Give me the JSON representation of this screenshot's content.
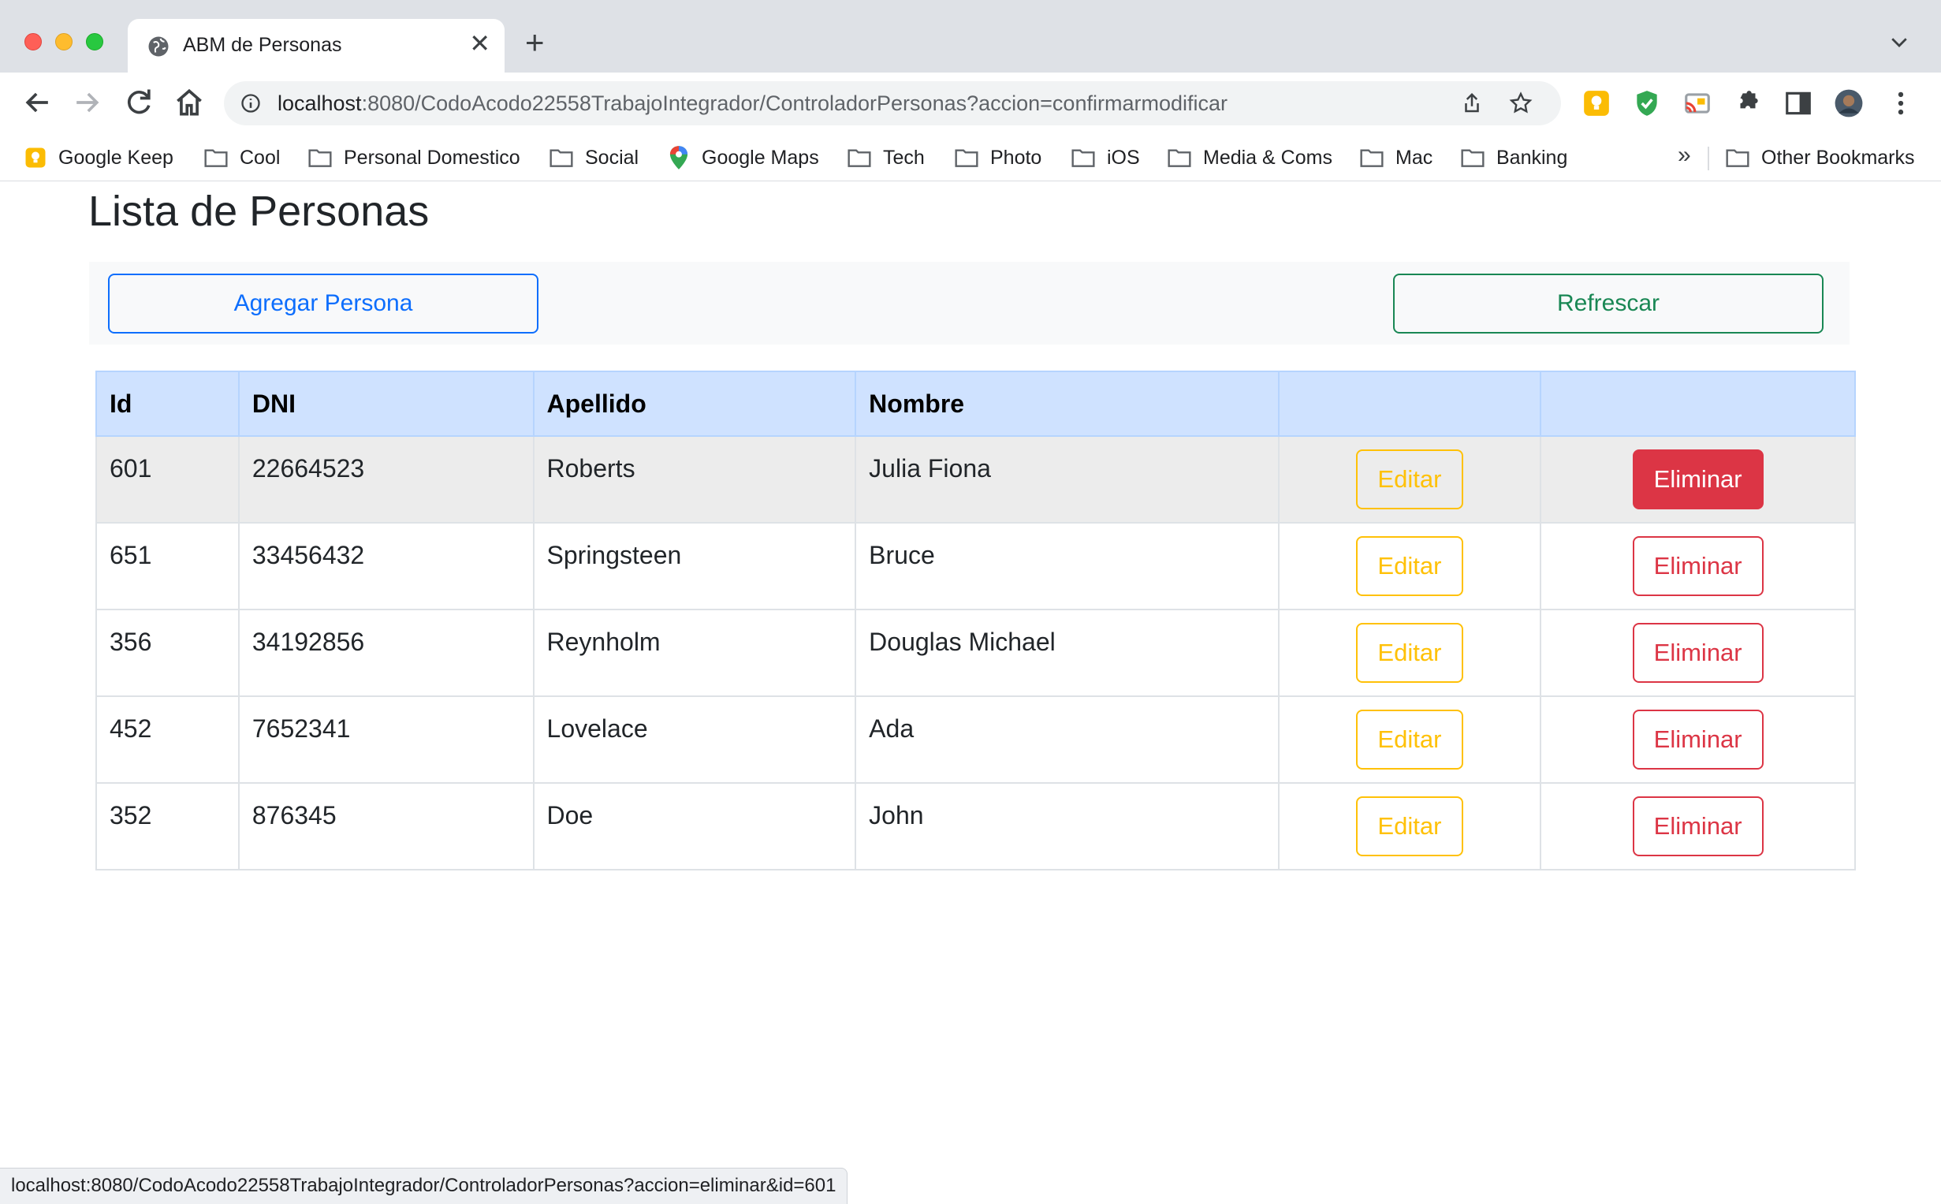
{
  "browser": {
    "tab_title": "ABM de Personas",
    "new_tab_symbol": "+",
    "close_symbol": "✕",
    "url_host": "localhost",
    "url_path": ":8080/CodoAcodo22558TrabajoIntegrador/ControladorPersonas?accion=confirmarmodificar",
    "bookmarks_more": "»",
    "bookmarks": [
      {
        "label": "Google Keep",
        "icon": "google-keep-icon"
      },
      {
        "label": "Cool",
        "icon": "folder-icon"
      },
      {
        "label": "Personal Domestico",
        "icon": "folder-icon"
      },
      {
        "label": "Social",
        "icon": "folder-icon"
      },
      {
        "label": "Google Maps",
        "icon": "google-maps-icon"
      },
      {
        "label": "Tech",
        "icon": "folder-icon"
      },
      {
        "label": "Photo",
        "icon": "folder-icon"
      },
      {
        "label": "iOS",
        "icon": "folder-icon"
      },
      {
        "label": "Media & Coms",
        "icon": "folder-icon"
      },
      {
        "label": "Mac",
        "icon": "folder-icon"
      },
      {
        "label": "Banking",
        "icon": "folder-icon"
      },
      {
        "label": "Other Bookmarks",
        "icon": "folder-icon"
      }
    ],
    "status_url": "localhost:8080/CodoAcodo22558TrabajoIntegrador/ControladorPersonas?accion=eliminar&id=601"
  },
  "page": {
    "title": "Lista de Personas",
    "add_button": "Agregar Persona",
    "refresh_button": "Refrescar",
    "table": {
      "headers": [
        "Id",
        "DNI",
        "Apellido",
        "Nombre",
        "",
        ""
      ],
      "edit_label": "Editar",
      "delete_label": "Eliminar",
      "rows": [
        {
          "id": "601",
          "dni": "22664523",
          "apellido": "Roberts",
          "nombre": "Julia Fiona"
        },
        {
          "id": "651",
          "dni": "33456432",
          "apellido": "Springsteen",
          "nombre": "Bruce"
        },
        {
          "id": "356",
          "dni": "34192856",
          "apellido": "Reynholm",
          "nombre": "Douglas Michael"
        },
        {
          "id": "452",
          "dni": "7652341",
          "apellido": "Lovelace",
          "nombre": "Ada"
        },
        {
          "id": "352",
          "dni": "876345",
          "apellido": "Doe",
          "nombre": "John"
        }
      ]
    }
  },
  "colors": {
    "primary": "#0d6efd",
    "success": "#198754",
    "warning": "#ffc107",
    "danger": "#dc3545",
    "table_header": "#cfe2ff"
  }
}
